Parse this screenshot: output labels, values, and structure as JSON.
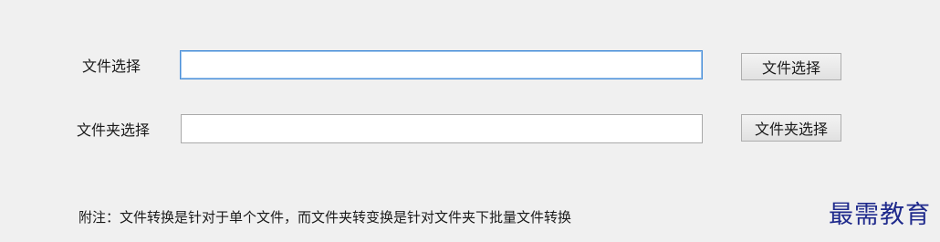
{
  "file_row": {
    "label": "文件选择",
    "input_value": "",
    "button_label": "文件选择"
  },
  "folder_row": {
    "label": "文件夹选择",
    "input_value": "",
    "button_label": "文件夹选择"
  },
  "note": "附注：文件转换是针对于单个文件，而文件夹转变换是针对文件夹下批量文件转换",
  "watermark": {
    "text": "最需教育",
    "color": "#1f2a8c"
  },
  "colors": {
    "background": "#f0f0f0",
    "focus_border": "#4a90d9"
  }
}
